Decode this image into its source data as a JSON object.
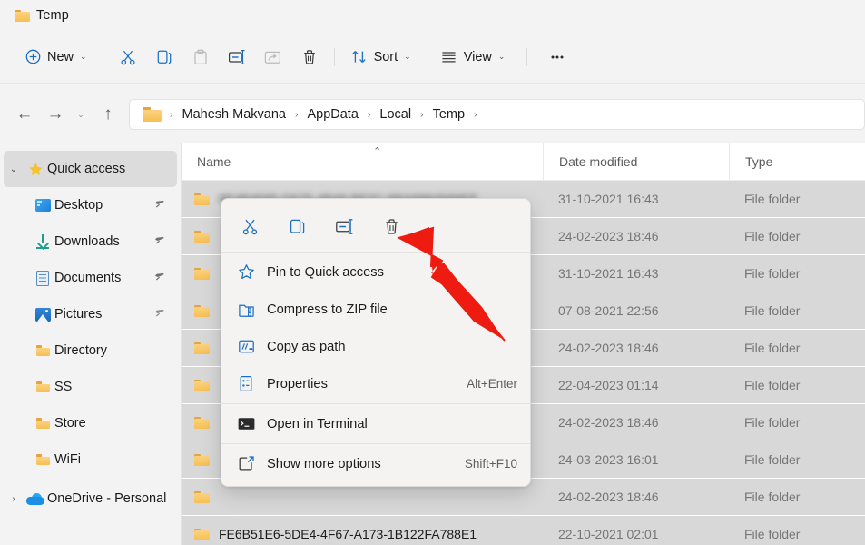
{
  "window": {
    "tab_title": "Temp",
    "tab_icon": "folder-icon"
  },
  "toolbar": {
    "new_label": "New",
    "new_icon": "plus-circle-icon",
    "cut_icon": "scissors-icon",
    "copy_icon": "copy-icon",
    "paste_icon": "paste-icon",
    "rename_icon": "rename-icon",
    "share_icon": "share-icon",
    "delete_icon": "trash-icon",
    "sort_label": "Sort",
    "sort_icon": "sort-arrows-icon",
    "view_label": "View",
    "view_icon": "list-lines-icon",
    "more_label": "...",
    "more_icon": "ellipsis-icon",
    "chevron": "⌄"
  },
  "navigation": {
    "back_icon": "arrow-left-icon",
    "forward_icon": "arrow-right-icon",
    "recent_icon": "chevron-down-icon",
    "up_icon": "arrow-up-icon",
    "breadcrumb_icon": "folder-icon",
    "breadcrumb": [
      "Mahesh Makvana",
      "AppData",
      "Local",
      "Temp"
    ],
    "separator": "›"
  },
  "sidebar": {
    "items": [
      {
        "label": "Quick access",
        "icon": "star-icon",
        "expander": "⌄",
        "selected": true,
        "indent": false,
        "pinned": false
      },
      {
        "label": "Desktop",
        "icon": "desktop-icon",
        "expander": "",
        "selected": false,
        "indent": true,
        "pinned": true
      },
      {
        "label": "Downloads",
        "icon": "download-icon",
        "expander": "",
        "selected": false,
        "indent": true,
        "pinned": true
      },
      {
        "label": "Documents",
        "icon": "document-icon",
        "expander": "",
        "selected": false,
        "indent": true,
        "pinned": true
      },
      {
        "label": "Pictures",
        "icon": "pictures-icon",
        "expander": "",
        "selected": false,
        "indent": true,
        "pinned": true
      },
      {
        "label": "Directory",
        "icon": "folder-icon",
        "expander": "",
        "selected": false,
        "indent": true,
        "pinned": false
      },
      {
        "label": "SS",
        "icon": "folder-icon",
        "expander": "",
        "selected": false,
        "indent": true,
        "pinned": false
      },
      {
        "label": "Store",
        "icon": "folder-icon",
        "expander": "",
        "selected": false,
        "indent": true,
        "pinned": false
      },
      {
        "label": "WiFi",
        "icon": "folder-icon",
        "expander": "",
        "selected": false,
        "indent": true,
        "pinned": false
      },
      {
        "label": "OneDrive - Personal",
        "icon": "cloud-icon",
        "expander": "›",
        "selected": false,
        "indent": false,
        "pinned": false
      }
    ],
    "pin_glyph": "📌"
  },
  "filelist": {
    "columns": [
      "Name",
      "Date modified",
      "Type"
    ],
    "sort_caret": "⌃",
    "rows": [
      {
        "name": "8E4B4585-D675-4B48-BF2C-6BA6884589EE",
        "blurred": true,
        "date": "31-10-2021 16:43",
        "type": "File folder"
      },
      {
        "name": "",
        "blurred": true,
        "date": "24-02-2023 18:46",
        "type": "File folder"
      },
      {
        "name": "",
        "blurred": true,
        "date": "31-10-2021 16:43",
        "type": "File folder"
      },
      {
        "name": "",
        "blurred": true,
        "date": "07-08-2021 22:56",
        "type": "File folder"
      },
      {
        "name": "",
        "blurred": true,
        "date": "24-02-2023 18:46",
        "type": "File folder"
      },
      {
        "name": "",
        "blurred": true,
        "date": "22-04-2023 01:14",
        "type": "File folder"
      },
      {
        "name": "",
        "blurred": true,
        "date": "24-02-2023 18:46",
        "type": "File folder"
      },
      {
        "name": "",
        "blurred": true,
        "date": "24-03-2023 16:01",
        "type": "File folder"
      },
      {
        "name": "",
        "blurred": true,
        "date": "24-02-2023 18:46",
        "type": "File folder"
      },
      {
        "name": "FE6B51E6-5DE4-4F67-A173-1B122FA788E1",
        "blurred": false,
        "date": "22-10-2021 02:01",
        "type": "File folder"
      }
    ]
  },
  "context_menu": {
    "icon_row": [
      {
        "name": "cut-icon",
        "glyph": "✂"
      },
      {
        "name": "copy-icon",
        "glyph": "❐"
      },
      {
        "name": "rename-icon",
        "glyph": "⊣"
      },
      {
        "name": "delete-icon",
        "glyph": "🗑"
      }
    ],
    "items": [
      {
        "label": "Pin to Quick access",
        "icon": "star-outline-icon",
        "shortcut": ""
      },
      {
        "label": "Compress to ZIP file",
        "icon": "zip-icon",
        "shortcut": ""
      },
      {
        "label": "Copy as path",
        "icon": "copy-path-icon",
        "shortcut": ""
      },
      {
        "label": "Properties",
        "icon": "properties-icon",
        "shortcut": "Alt+Enter"
      },
      {
        "label": "Open in Terminal",
        "icon": "terminal-icon",
        "shortcut": ""
      },
      {
        "label": "Show more options",
        "icon": "show-more-icon",
        "shortcut": "Shift+F10"
      }
    ],
    "dividers_after": [
      3,
      4
    ]
  },
  "annotation": {
    "arrow_color": "#ee1b11",
    "arrow_target": "delete-icon"
  }
}
